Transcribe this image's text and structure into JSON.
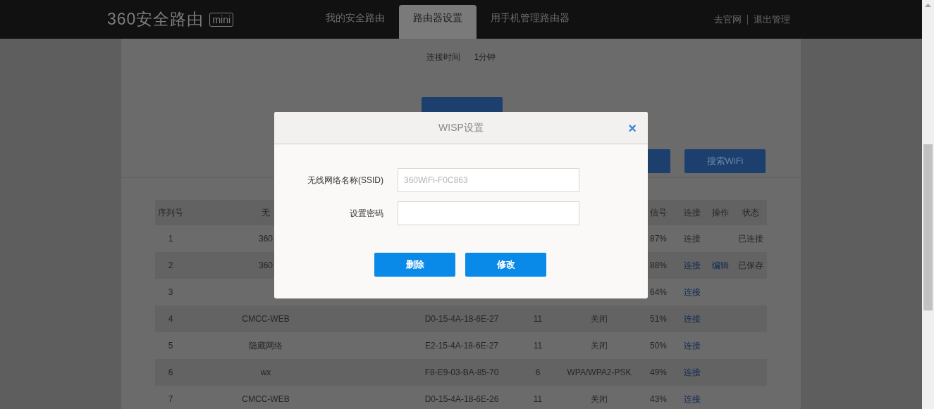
{
  "header": {
    "logo": "360安全路由",
    "logo_badge": "mini",
    "tabs": [
      {
        "label": "我的安全路由",
        "selected": false
      },
      {
        "label": "路由器设置",
        "selected": true
      },
      {
        "label": "用手机管理路由器",
        "selected": false
      }
    ],
    "links": [
      "去官网",
      "退出管理"
    ]
  },
  "connection": {
    "label": "连接时间",
    "value": "1分钟"
  },
  "search_button": "搜索WiFi",
  "table": {
    "columns": {
      "index": "序列号",
      "ssid": "无",
      "signal": "信号",
      "connect": "连接",
      "action": "操作",
      "status": "状态"
    },
    "rows": [
      {
        "index": "1",
        "ssid": "360",
        "signal": "87%",
        "connect": "连接",
        "connect_enabled": false,
        "status": "已连接"
      },
      {
        "index": "2",
        "ssid": "360",
        "signal": "88%",
        "connect": "连接",
        "connect_enabled": true,
        "action": "编辑",
        "status": "已保存"
      },
      {
        "index": "3",
        "signal": "64%",
        "connect": "连接",
        "connect_enabled": true
      },
      {
        "index": "4",
        "ssid": "CMCC-WEB",
        "mac": "D0-15-4A-18-6E-27",
        "channel": "11",
        "encryption": "关闭",
        "signal": "51%",
        "connect": "连接",
        "connect_enabled": true
      },
      {
        "index": "5",
        "ssid": "隐藏网络",
        "mac": "E2-15-4A-18-6E-27",
        "channel": "11",
        "encryption": "关闭",
        "signal": "50%",
        "connect": "连接",
        "connect_enabled": true
      },
      {
        "index": "6",
        "ssid": "wx",
        "mac": "F8-E9-03-BA-85-70",
        "channel": "6",
        "encryption": "WPA/WPA2-PSK",
        "signal": "49%",
        "connect": "连接",
        "connect_enabled": true
      },
      {
        "index": "7",
        "ssid": "CMCC-WEB",
        "mac": "D0-15-4A-18-6E-26",
        "channel": "11",
        "encryption": "关闭",
        "signal": "43%",
        "connect": "连接",
        "connect_enabled": true
      }
    ]
  },
  "dialog": {
    "title": "WISP设置",
    "close": "×",
    "fields": [
      {
        "label": "无线网络名称(SSID)",
        "placeholder": "360WiFi-F0C863"
      },
      {
        "label": "设置密码"
      }
    ],
    "buttons": [
      "删除",
      "修改"
    ]
  }
}
